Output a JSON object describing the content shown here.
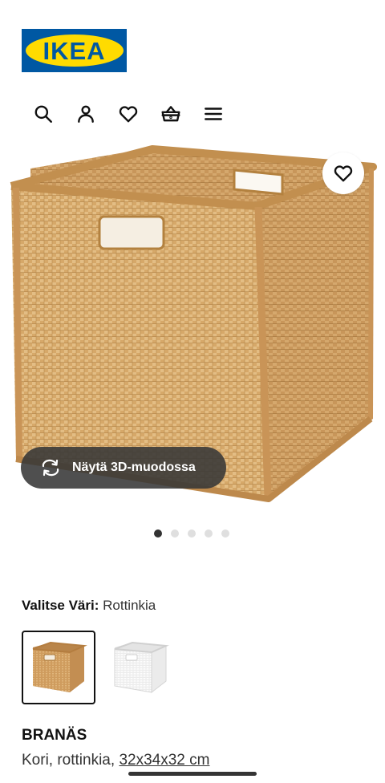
{
  "header": {
    "logo_text": "IKEA",
    "icons": [
      "search-icon",
      "user-icon",
      "heart-icon",
      "basket-icon",
      "menu-icon"
    ]
  },
  "gallery": {
    "favorite_icon": "heart-icon",
    "view_3d_label": "Näytä 3D-muodossa",
    "view_3d_icon": "rotate-icon",
    "dots_count": 5,
    "active_dot": 1
  },
  "color_selector": {
    "label": "Valitse Väri:",
    "value": "Rottinkia",
    "options": [
      "Rottinkia",
      "Valkoinen"
    ]
  },
  "product": {
    "name": "BRANÄS",
    "description_prefix": "Kori, rottinkia,",
    "dimensions": "32x34x32 cm"
  },
  "colors": {
    "logo_blue": "#0058a3",
    "logo_yellow": "#ffdb00",
    "rattan": "#d8aa6e"
  }
}
